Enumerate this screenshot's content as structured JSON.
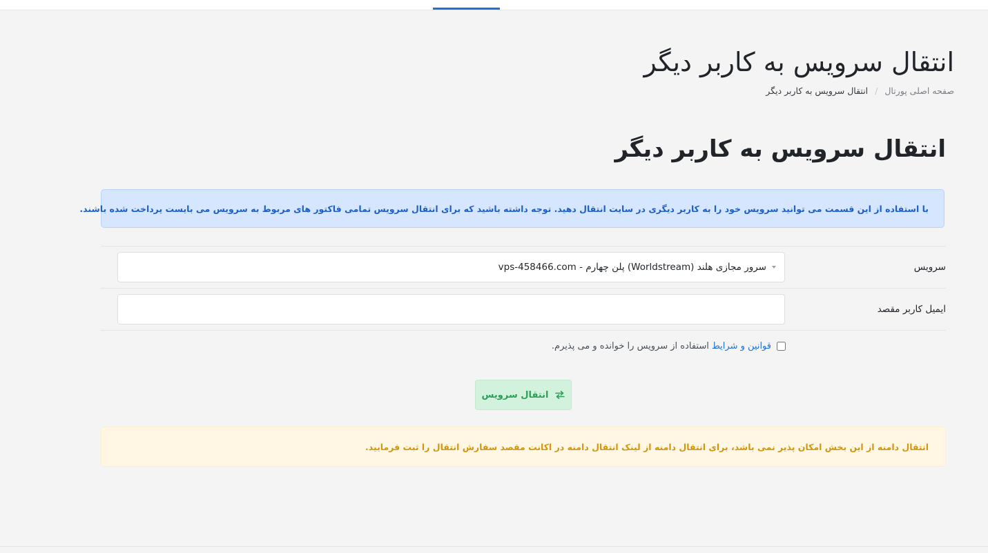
{
  "header": {
    "title": "انتقال سرویس به کاربر دیگر",
    "breadcrumb": {
      "home": "صفحه اصلی پورتال",
      "separator": "/",
      "current": "انتقال سرویس به کاربر دیگر"
    }
  },
  "content": {
    "heading": "انتقال سرویس به کاربر دیگر",
    "info_alert": "با استفاده از این قسمت می توانید سرویس خود را به کاربر دیگری در سایت انتقال دهید. توجه داشته باشید که برای انتقال سرویس تمامی فاکتور های مربوط به سرویس می بایست پرداخت شده باشند.",
    "form": {
      "service_label": "سرویس",
      "service_value": "سرور مجازی هلند (Worldstream) پلن چهارم - vps-458466.com",
      "email_label": "ایمیل کاربر مقصد",
      "email_value": "",
      "terms_link": "قوانین و شرایط",
      "terms_suffix": "استفاده از سرویس را خوانده و می پذیرم.",
      "terms_checked": false,
      "submit_label": "انتقال سرویس"
    },
    "warning_alert": "انتقال دامنه از این بخش امکان پذیر نمی باشد، برای انتقال دامنه از لینک انتقال دامنه در اکانت مقصد سفارش انتقال را ثبت فرمایید."
  },
  "colors": {
    "accent": "#1e6fd9",
    "info_bg": "#d6e6ff",
    "info_text": "#1c5fc7",
    "success_bg": "#d3f2dd",
    "success_text": "#2e9d57",
    "warning_bg": "#fff7e3",
    "warning_text": "#d1960f"
  },
  "icons": {
    "submit": "exchange-arrows-icon",
    "select": "chevron-down-icon"
  }
}
